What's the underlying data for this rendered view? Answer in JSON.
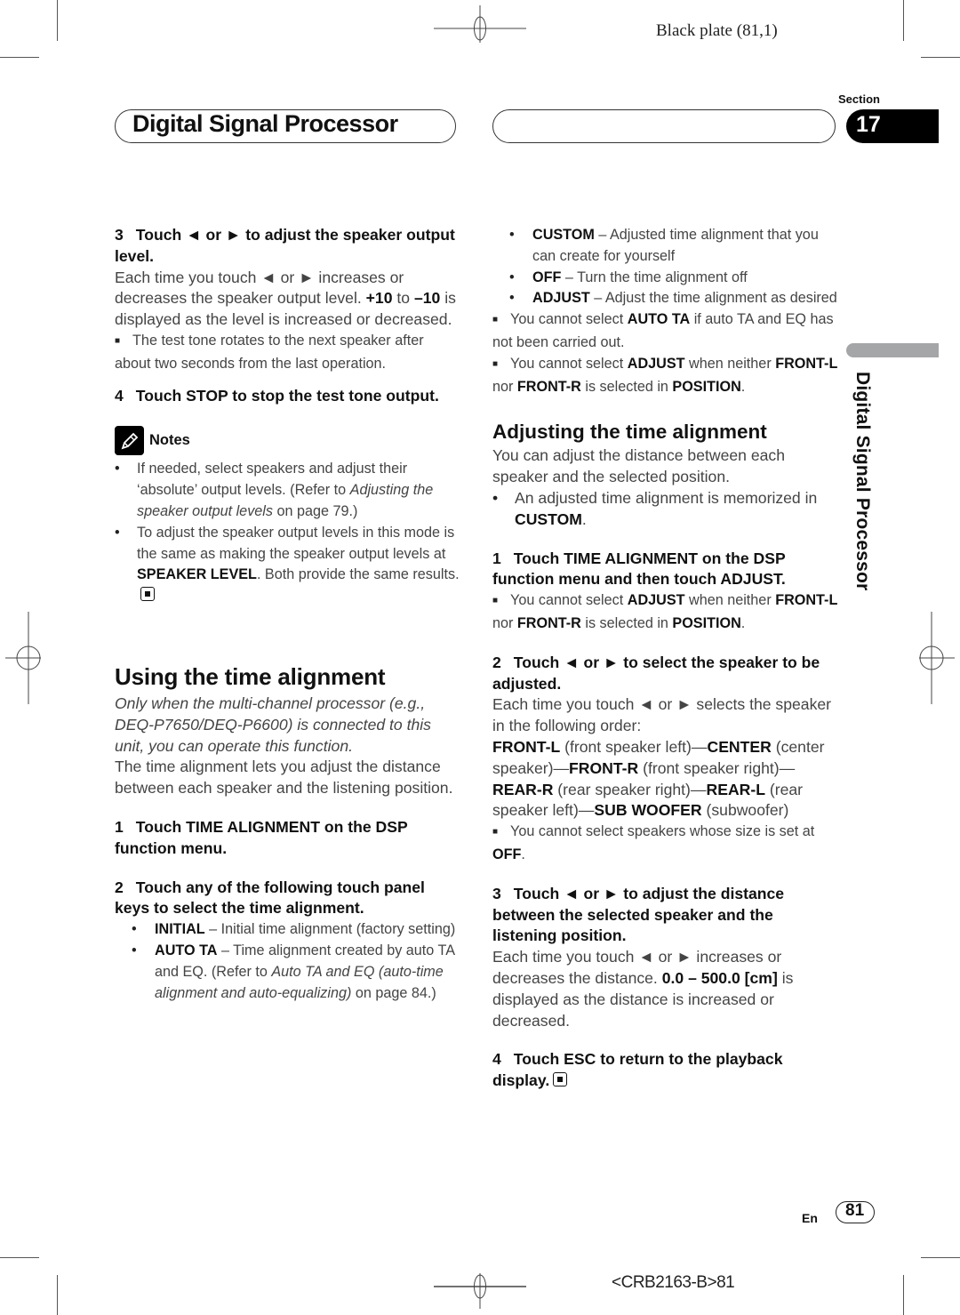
{
  "print_marks": {
    "plate_text": "Black plate (81,1)",
    "job_code": "<CRB2163-B>81"
  },
  "header": {
    "title": "Digital Signal Processor",
    "section_label": "Section",
    "section_number": "17"
  },
  "side_tab": {
    "text": "Digital Signal Processor",
    "bar_color": "#a4a6a8"
  },
  "left_column": {
    "step3": {
      "num": "3",
      "text": "Touch ◄ or ► to adjust the speaker output level.",
      "body_a": "Each time you touch ◄ or ► increases or decreases the speaker output level. ",
      "body_bold1": "+10",
      "body_mid": " to ",
      "body_bold2": "–10",
      "body_b": " is displayed as the level is increased or decreased.",
      "note": "The test tone rotates to the next speaker after about two seconds from the last operation."
    },
    "step4": {
      "num": "4",
      "text": "Touch STOP to stop the test tone output."
    },
    "notes": {
      "label": "Notes",
      "items": [
        {
          "pre": "If needed, select speakers and adjust their ‘absolute’ output levels. (Refer to ",
          "italic": "Adjusting the speaker output levels",
          "post": " on page 79.)"
        },
        {
          "pre": "To adjust the speaker output levels in this mode is the same as making the speaker output levels at ",
          "bold": "SPEAKER LEVEL",
          "post": ". Both provide the same results."
        }
      ]
    },
    "using_section": {
      "title": "Using the time alignment",
      "italic_intro": "Only when the multi-channel processor (e.g., DEQ-P7650/DEQ-P6600) is connected to this unit, you can operate this function.",
      "body": "The time alignment lets you adjust the distance between each speaker and the listening position.",
      "step1": {
        "num": "1",
        "text": "Touch TIME ALIGNMENT on the DSP function menu."
      },
      "step2": {
        "num": "2",
        "text": "Touch any of the following touch panel keys to select the time alignment."
      },
      "options": [
        {
          "key": "INITIAL",
          "desc": " – Initial time alignment (factory setting)"
        },
        {
          "key": "AUTO TA",
          "desc_pre": " – Time alignment created by auto TA and EQ. (Refer to ",
          "desc_italic": "Auto TA and EQ (auto-time alignment and auto-equalizing)",
          "desc_post": " on page 84.)"
        }
      ]
    }
  },
  "right_column": {
    "options_cont": [
      {
        "key": "CUSTOM",
        "desc": " – Adjusted time alignment that you can create for yourself"
      },
      {
        "key": "OFF",
        "desc": " – Turn the time alignment off"
      },
      {
        "key": "ADJUST",
        "desc": " – Adjust the time alignment as desired"
      }
    ],
    "note1": {
      "pre": "You cannot select ",
      "bold": "AUTO TA",
      "post": " if auto TA and EQ has not been carried out."
    },
    "note2": {
      "pre": "You cannot select ",
      "bold": "ADJUST",
      "mid": " when neither ",
      "b2": "FRONT-L",
      "nor": " nor ",
      "b3": "FRONT-R",
      "is": " is selected in ",
      "b4": "POSITION",
      "end": "."
    },
    "adjusting_section": {
      "title": "Adjusting the time alignment",
      "body": "You can adjust the distance between each speaker and the selected position.",
      "bullet_pre": "An adjusted time alignment is memorized in ",
      "bullet_bold": "CUSTOM",
      "bullet_end": ".",
      "step1": {
        "num": "1",
        "text": "Touch TIME ALIGNMENT on the DSP function menu and then touch ADJUST."
      },
      "step1_note": {
        "pre": "You cannot select ",
        "bold": "ADJUST",
        "mid": " when neither ",
        "b2": "FRONT-L",
        "nor": " nor ",
        "b3": "FRONT-R",
        "is": " is selected in ",
        "b4": "POSITION",
        "end": "."
      },
      "step2": {
        "num": "2",
        "text": "Touch ◄ or ► to select the speaker to be adjusted."
      },
      "step2_body": "Each time you touch ◄ or ► selects the speaker in the following order:",
      "speaker_order": [
        {
          "key": "FRONT-L",
          "desc": " (front speaker left)—"
        },
        {
          "key": "CENTER",
          "desc": " (center speaker)—"
        },
        {
          "key": "FRONT-R",
          "desc": " (front speaker right)—"
        },
        {
          "key": "REAR-R",
          "desc": " (rear speaker right)—"
        },
        {
          "key": "REAR-L",
          "desc": " (rear speaker left)—"
        },
        {
          "key": "SUB WOOFER",
          "desc": " (subwoofer)"
        }
      ],
      "step2_note": {
        "pre": "You cannot select speakers whose size is set at ",
        "bold": "OFF",
        "end": "."
      },
      "step3": {
        "num": "3",
        "text": "Touch ◄ or ► to adjust the distance between the selected speaker and the listening position."
      },
      "step3_body": {
        "pre": "Each time you touch ◄ or ► increases or decreases the distance. ",
        "bold": "0.0 – 500.0 [cm]",
        "post": " is displayed as the distance is increased or decreased."
      },
      "step4": {
        "num": "4",
        "text": "Touch ESC to return to the playback display."
      }
    }
  },
  "footer": {
    "lang": "En",
    "page_number": "81"
  }
}
